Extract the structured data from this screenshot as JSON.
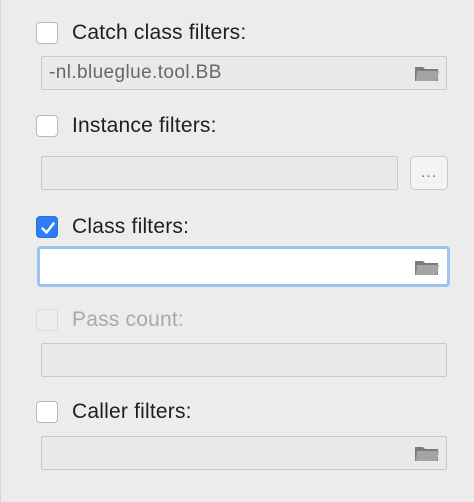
{
  "filters": {
    "catch_class": {
      "label": "Catch class filters:",
      "checked": false,
      "value": "-nl.blueglue.tool.BB"
    },
    "instance": {
      "label": "Instance filters:",
      "checked": false,
      "value": "",
      "browse_label": "..."
    },
    "class": {
      "label": "Class filters:",
      "checked": true,
      "value": ""
    },
    "pass_count": {
      "label": "Pass count:",
      "checked": false,
      "enabled": false,
      "value": ""
    },
    "caller": {
      "label": "Caller filters:",
      "checked": false,
      "value": ""
    }
  },
  "colors": {
    "panel_bg": "#ececec",
    "accent": "#2f7cf6",
    "focus_ring": "#9cc2ef"
  },
  "icons": {
    "browse": "folder-icon",
    "check": "checkmark-icon"
  }
}
